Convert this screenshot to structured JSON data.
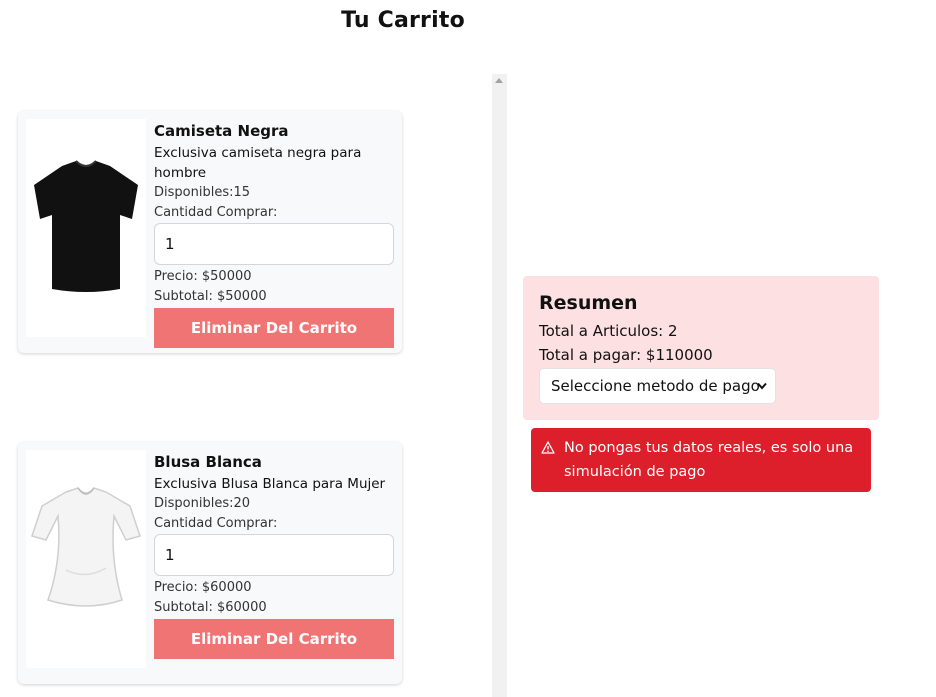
{
  "page": {
    "title": "Tu Carrito"
  },
  "cart": {
    "qty_label": "Cantidad Comprar:",
    "remove_label": "Eliminar Del Carrito",
    "items": [
      {
        "name": "Camiseta Negra",
        "description": "Exclusiva camiseta negra para hombre",
        "stock": "Disponibles:15",
        "quantity": "1",
        "price": "Precio: $50000",
        "subtotal": "Subtotal: $50000",
        "image_icon": "black-tshirt-icon",
        "image_color": "#111111"
      },
      {
        "name": "Blusa Blanca",
        "description": "Exclusiva Blusa Blanca para Mujer",
        "stock": "Disponibles:20",
        "quantity": "1",
        "price": "Precio: $60000",
        "subtotal": "Subtotal: $60000",
        "image_icon": "white-blouse-icon",
        "image_color": "#f4f4f4"
      }
    ]
  },
  "summary": {
    "title": "Resumen",
    "total_items": "Total a Articulos: 2",
    "total_pay": "Total a pagar: $110000",
    "payment_select": {
      "selected": "Seleccione metodo de pago"
    }
  },
  "alert": {
    "text": "No pongas tus datos reales, es solo una simulación de pago",
    "icon": "warning-triangle-icon"
  },
  "colors": {
    "remove_button": "#f07474",
    "summary_bg": "#fde0e2",
    "alert_bg": "#dc1f2b"
  }
}
